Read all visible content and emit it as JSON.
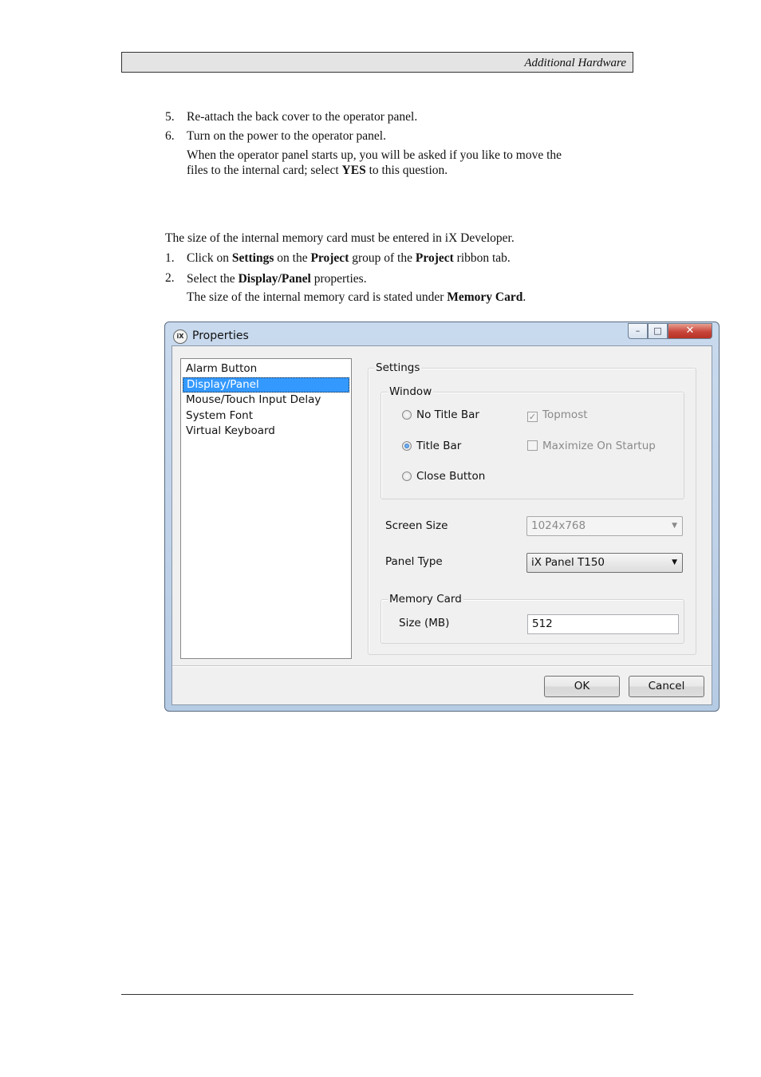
{
  "header": {
    "title": "Additional Hardware"
  },
  "steps_a": [
    {
      "num": "5.",
      "text": "Re-attach the back cover to the operator panel."
    },
    {
      "num": "6.",
      "text": "Turn on the power to the operator panel."
    }
  ],
  "step6_note": {
    "line1": "When the operator panel starts up, you will be asked if you like to move the",
    "line2a": "files to the internal card; select ",
    "line2b": "YES",
    "line2c": " to this question."
  },
  "intro": "The size of the internal memory card must be entered in iX Developer.",
  "step1": {
    "num": "1.",
    "t1": "Click on ",
    "b1": "Settings",
    "t2": " on the ",
    "b2": "Project",
    "t3": " group of the ",
    "b3": "Project",
    "t4": " ribbon tab."
  },
  "step2": {
    "num": "2.",
    "t1": "Select the ",
    "b1": "Display/Panel",
    "t2": " properties."
  },
  "step2_note": {
    "t1": "The size of the internal memory card is stated under ",
    "b1": "Memory Card",
    "t2": "."
  },
  "dialog": {
    "app_icon": "iX",
    "title": "Properties",
    "caption": {
      "minimize": "–",
      "maximize": "□",
      "close": "✕"
    },
    "list_items": [
      "Alarm Button",
      "Display/Panel",
      "Mouse/Touch Input Delay",
      "System Font",
      "Virtual Keyboard"
    ],
    "selected_index": 1,
    "settings_label": "Settings",
    "window_label": "Window",
    "radios": {
      "no_title_bar": "No Title Bar",
      "title_bar": "Title Bar",
      "close_button": "Close Button"
    },
    "checks": {
      "topmost": "Topmost",
      "maximize_on_startup": "Maximize On Startup"
    },
    "screen_size_label": "Screen Size",
    "screen_size_value": "1024x768",
    "panel_type_label": "Panel Type",
    "panel_type_value": "iX Panel T150",
    "memory_card_label": "Memory Card",
    "size_label": "Size (MB)",
    "size_value": "512",
    "ok": "OK",
    "cancel": "Cancel"
  }
}
